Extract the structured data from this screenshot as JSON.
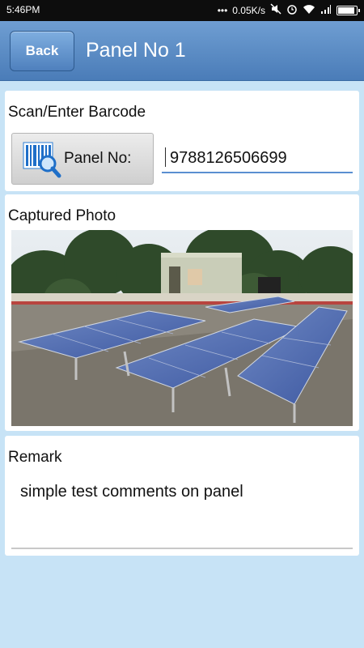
{
  "status_bar": {
    "time": "5:46PM",
    "network_speed": "0.05K/s",
    "icons": [
      "notification-icon",
      "dots-icon",
      "mute-icon",
      "alarm-icon",
      "wifi-icon",
      "signal-icon",
      "battery-icon"
    ],
    "battery_level": 0.9
  },
  "app_bar": {
    "back_label": "Back",
    "title": "Panel No 1",
    "colors": {
      "bar": "#5a8cc6",
      "text": "#ffffff"
    }
  },
  "barcode_section": {
    "heading": "Scan/Enter Barcode",
    "scan_button_label": "Panel No:",
    "scan_icon": "barcode-scan-icon",
    "panel_number": "9788126506699"
  },
  "photo_section": {
    "heading": "Captured Photo",
    "image_subject": "rooftop solar panel array"
  },
  "remark_section": {
    "heading": "Remark",
    "text": "simple test comments on panel"
  },
  "colors": {
    "background": "#c7e3f6",
    "card": "#ffffff",
    "accent": "#5a8fd1"
  }
}
